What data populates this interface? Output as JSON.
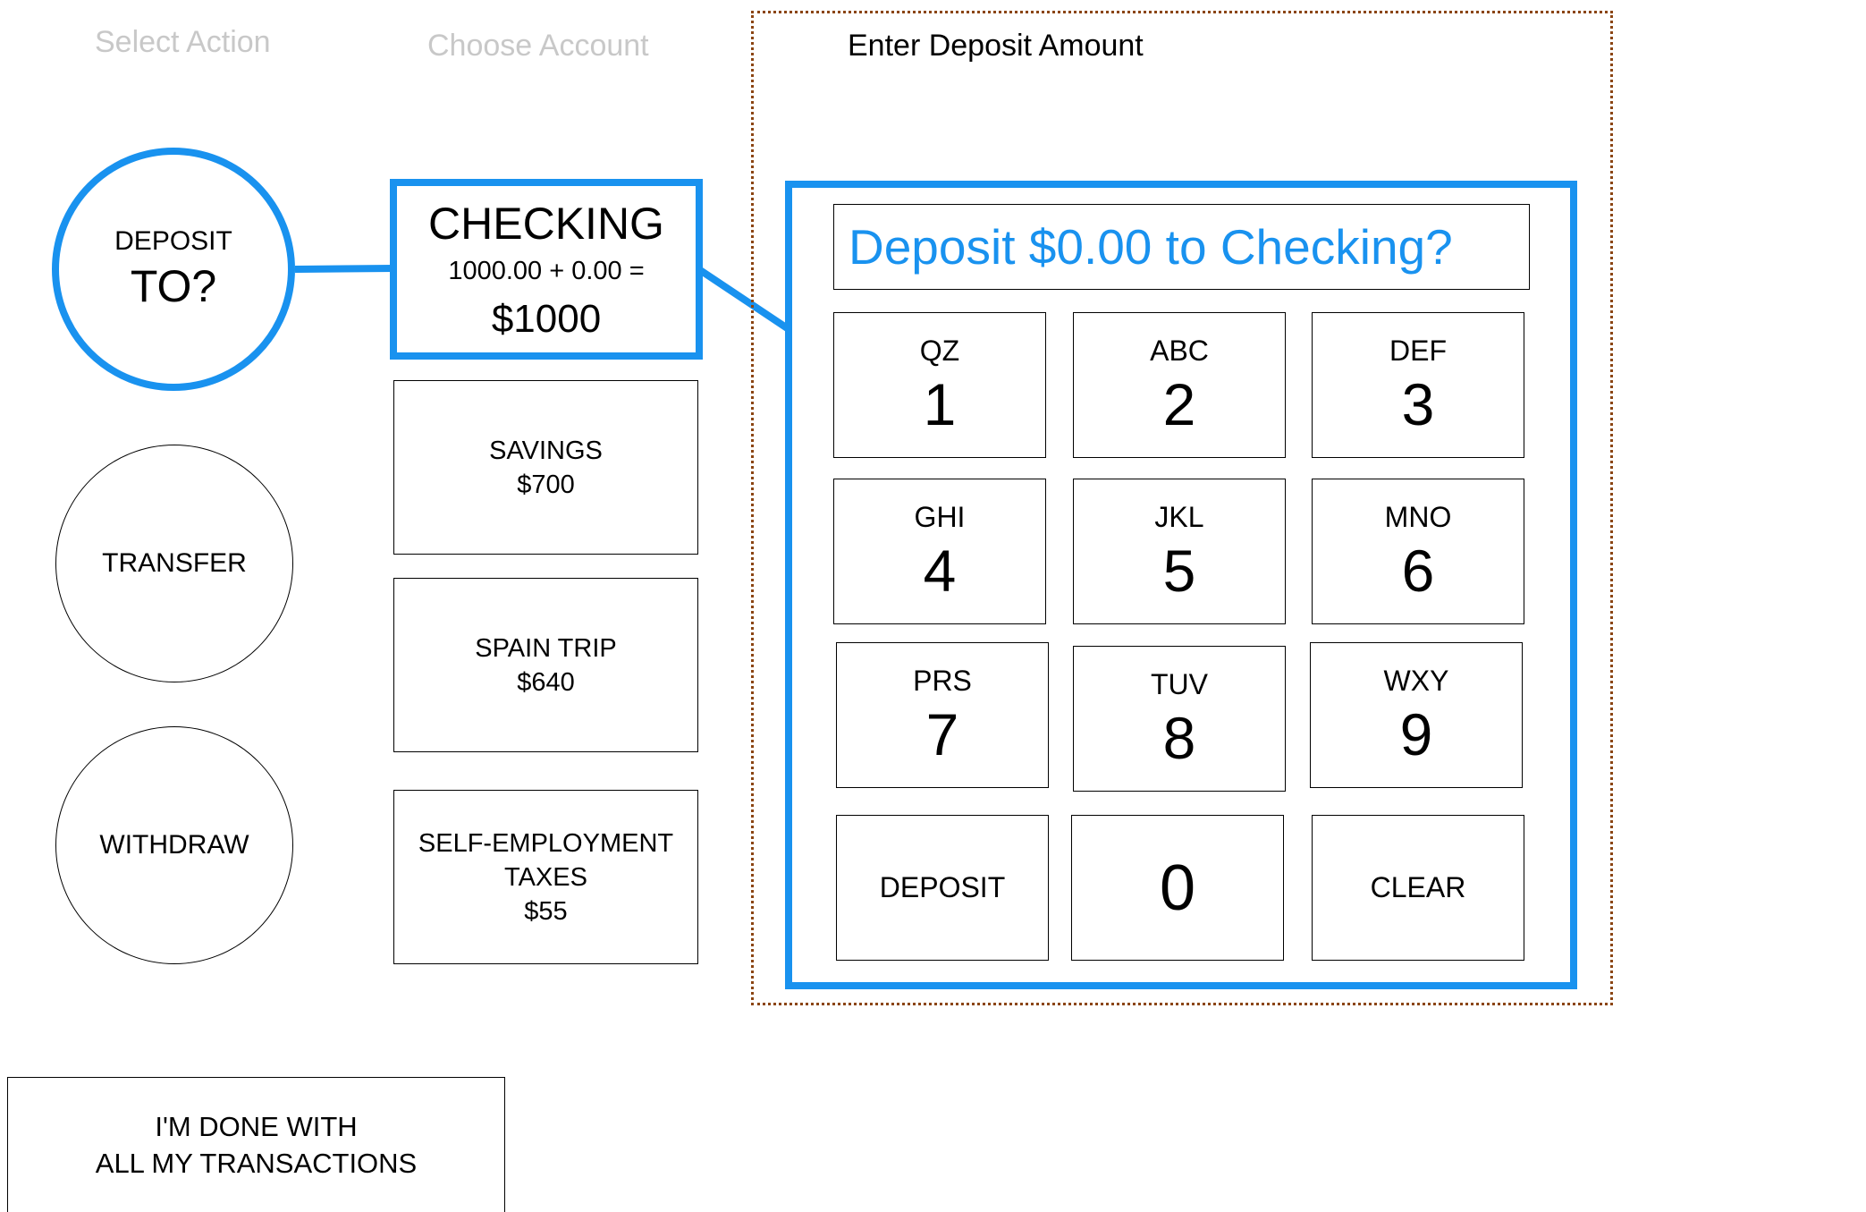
{
  "steps": {
    "select_action": "Select Action",
    "choose_account": "Choose Account",
    "enter_amount": "Enter Deposit Amount"
  },
  "actions": {
    "deposit": {
      "line1": "DEPOSIT",
      "line2": "TO?"
    },
    "transfer": "TRANSFER",
    "withdraw": "WITHDRAW"
  },
  "accounts": {
    "checking": {
      "name": "CHECKING",
      "calc": "1000.00 + 0.00 =",
      "total": "$1000"
    },
    "savings": {
      "name": "SAVINGS",
      "amount": "$700"
    },
    "spain_trip": {
      "name": "SPAIN TRIP",
      "amount": "$640"
    },
    "taxes": {
      "line1": "SELF-EMPLOYMENT",
      "line2": "TAXES",
      "amount": "$55"
    }
  },
  "keypad": {
    "display": "Deposit $0.00 to Checking?",
    "keys": [
      {
        "letters": "QZ",
        "digit": "1"
      },
      {
        "letters": "ABC",
        "digit": "2"
      },
      {
        "letters": "DEF",
        "digit": "3"
      },
      {
        "letters": "GHI",
        "digit": "4"
      },
      {
        "letters": "JKL",
        "digit": "5"
      },
      {
        "letters": "MNO",
        "digit": "6"
      },
      {
        "letters": "PRS",
        "digit": "7"
      },
      {
        "letters": "TUV",
        "digit": "8"
      },
      {
        "letters": "WXY",
        "digit": "9"
      }
    ],
    "deposit_label": "DEPOSIT",
    "zero": "0",
    "clear_label": "CLEAR"
  },
  "done": {
    "line1": "I'M DONE WITH",
    "line2": "ALL MY TRANSACTIONS"
  },
  "colors": {
    "accent": "#1992ef",
    "dotted_border": "#8b4513",
    "inactive_text": "#c8c8c8"
  }
}
